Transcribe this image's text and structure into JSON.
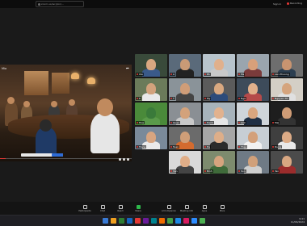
{
  "browser": {
    "url": "zoom.us/wc/join/...",
    "sign_in": "Sign in",
    "recording": "Recording"
  },
  "shared_screen": {
    "title": "Mia",
    "progress_fraction": 0.04
  },
  "participants": [
    {
      "name": "Xia",
      "face": "#d9a781",
      "body": "#3a5a8a",
      "bg": "#394a3a"
    },
    {
      "name": "A",
      "face": "#c99a76",
      "body": "#222",
      "bg": "#5a6a7a"
    },
    {
      "name": "PA",
      "face": "#e0b08c",
      "body": "#c9c9c9",
      "bg": "#b8c4cc"
    },
    {
      "name": "Ms",
      "face": "#d8a07a",
      "body": "#7a3b3b",
      "bg": "#9aa5ae"
    },
    {
      "name": "Lan Phuong",
      "face": "#c89470",
      "body": "#2c3e50",
      "bg": "#6e6e6e"
    },
    {
      "name": "K",
      "face": "#d2a27c",
      "body": "#e9e9e9",
      "bg": "#6b7b5a"
    },
    {
      "name": "T",
      "face": "#cf9d78",
      "body": "#444",
      "bg": "#8a9399"
    },
    {
      "name": "My",
      "face": "#d9a880",
      "body": "#2d4b7a",
      "bg": "#5b5b5b"
    },
    {
      "name": "Nga",
      "face": "#e1b08b",
      "body": "#b54a4a",
      "bg": "#3d4b5a"
    },
    {
      "name": "Nguyen Thi",
      "face": "#d5a47d",
      "body": "#e0e0e0",
      "bg": "#d4cfc6"
    },
    {
      "name": "Hoa",
      "face": "#3a7a3a",
      "body": "#5a9a4a",
      "bg": "#4a8a3a"
    },
    {
      "name": "Quan",
      "face": "#d3a27b",
      "body": "#c9c9c9",
      "bg": "#8a8f94"
    },
    {
      "name": "Hanh",
      "face": "#e2b28e",
      "body": "#e6e6e6",
      "bg": "#a7b3bb"
    },
    {
      "name": "Linh",
      "face": "#d9a67f",
      "body": "#1f2f44",
      "bg": "#cfd5da"
    },
    {
      "name": "Mai",
      "face": "#cf9c76",
      "body": "#333",
      "bg": "#1e1e1e"
    },
    {
      "name": "Trang",
      "face": "#d8a580",
      "body": "#eaeaea",
      "bg": "#7a8a9a"
    },
    {
      "name": "Tuan",
      "face": "#cf9e78",
      "body": "#d36b2f",
      "bg": "#6b6b6b"
    },
    {
      "name": "Ha",
      "face": "#deae89",
      "body": "#2b2b2b",
      "bg": "#a6a6a6"
    },
    {
      "name": "Thao",
      "face": "#d3a07a",
      "body": "#f1f1f1",
      "bg": "#c7ced4"
    },
    {
      "name": "Dung",
      "face": "#dcab86",
      "body": "#e9e9e9",
      "bg": "#3f3f3f"
    },
    {
      "name": "Binh",
      "face": "#d6a47e",
      "body": "#3f6b3a",
      "bg": "#7d8b6e"
    },
    {
      "name": "Son",
      "face": "#d0a07a",
      "body": "#cfcfcf",
      "bg": "#6f7a85"
    },
    {
      "name": "Van",
      "face": "#e0ae88",
      "body": "#444",
      "bg": "#d9d9d9"
    },
    {
      "name": "Yen",
      "face": "#d8a782",
      "body": "#9b2c2c",
      "bg": "#4b4b4b"
    }
  ],
  "toolbar": [
    {
      "name": "mic",
      "label": "Participants"
    },
    {
      "name": "video",
      "label": "Chat"
    },
    {
      "name": "react",
      "label": "React"
    },
    {
      "name": "share",
      "label": "Share",
      "green": true
    },
    {
      "name": "ai",
      "label": "AI Companion"
    },
    {
      "name": "record",
      "label": "Meeting info"
    },
    {
      "name": "apps",
      "label": "Apps"
    },
    {
      "name": "more",
      "label": "More"
    }
  ],
  "taskbar": {
    "apps": [
      "#3a7bd5",
      "#f0a020",
      "#2e7d32",
      "#1565c0",
      "#e53935",
      "#6a1b9a",
      "#00838f",
      "#ef6c00",
      "#43a047",
      "#1e88e5",
      "#d81b60",
      "#2d8cff",
      "#4caf50"
    ],
    "time": "9:41",
    "date": "11/06/2024"
  }
}
